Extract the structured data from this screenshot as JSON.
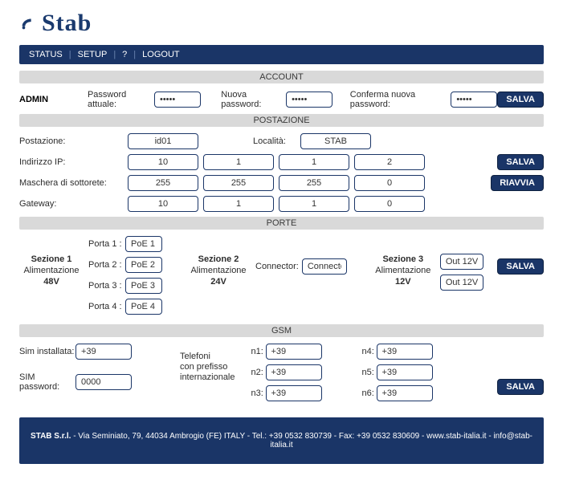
{
  "brand": "Stab",
  "nav": {
    "status": "STATUS",
    "setup": "SETUP",
    "help": "?",
    "logout": "LOGOUT"
  },
  "buttons": {
    "save": "SALVA",
    "reboot": "RIAVVIA"
  },
  "account": {
    "section": "ACCOUNT",
    "admin": "ADMIN",
    "current_pw_label": "Password attuale:",
    "current_pw_value": "•••••",
    "new_pw_label": "Nuova password:",
    "new_pw_value": "•••••",
    "confirm_pw_label": "Conferma nuova password:",
    "confirm_pw_value": "•••••"
  },
  "location": {
    "section": "POSTAZIONE",
    "station_label": "Postazione:",
    "station_value": "id01",
    "locality_label": "Località:",
    "locality_value": "STAB",
    "ip_label": "Indirizzo IP:",
    "ip": [
      "10",
      "1",
      "1",
      "2"
    ],
    "mask_label": "Maschera di sottorete:",
    "mask": [
      "255",
      "255",
      "255",
      "0"
    ],
    "gw_label": "Gateway:",
    "gw": [
      "10",
      "1",
      "1",
      "0"
    ]
  },
  "ports": {
    "section": "PORTE",
    "sez1": {
      "title": "Sezione 1",
      "sub1": "Alimentazione",
      "sub2": "48V",
      "p1l": "Porta 1 :",
      "p1v": "PoE 1",
      "p2l": "Porta 2 :",
      "p2v": "PoE 2",
      "p3l": "Porta 3 :",
      "p3v": "PoE 3",
      "p4l": "Porta 4 :",
      "p4v": "PoE 4"
    },
    "sez2": {
      "title": "Sezione 2",
      "sub1": "Alimentazione",
      "sub2": "24V",
      "conn_label": "Connector:",
      "conn_value": "Connector"
    },
    "sez3": {
      "title": "Sezione 3",
      "sub1": "Alimentazione",
      "sub2": "12V",
      "out1": "Out 12V",
      "out2": "Out 12V"
    }
  },
  "gsm": {
    "section": "GSM",
    "sim_inst_label": "Sim installata:",
    "sim_inst_value": "+39",
    "sim_pw_label": "SIM password:",
    "sim_pw_value": "0000",
    "phones_label1": "Telefoni",
    "phones_label2": "con prefisso",
    "phones_label3": "internazionale",
    "n1l": "n1:",
    "n1v": "+39",
    "n2l": "n2:",
    "n2v": "+39",
    "n3l": "n3:",
    "n3v": "+39",
    "n4l": "n4:",
    "n4v": "+39",
    "n5l": "n5:",
    "n5v": "+39",
    "n6l": "n6:",
    "n6v": "+39"
  },
  "footer": {
    "company": "STAB S.r.l.",
    "text": " - Via Seminiato, 79, 44034 Ambrogio (FE) ITALY - Tel.: +39 0532 830739 - Fax: +39 0532 830609 - www.stab-italia.it - info@stab-italia.it"
  }
}
